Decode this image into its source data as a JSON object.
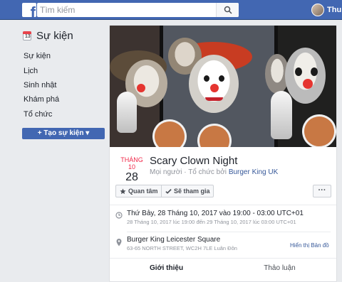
{
  "header": {
    "logo": "f",
    "search_placeholder": "Tìm kiếm",
    "user_name": "Thu"
  },
  "sidebar": {
    "title": "Sự kiện",
    "calendar_day": "13",
    "items": [
      {
        "label": "Sự kiện"
      },
      {
        "label": "Lịch"
      },
      {
        "label": "Sinh nhật"
      },
      {
        "label": "Khám phá"
      },
      {
        "label": "Tổ chức"
      }
    ],
    "create_button": "+ Tạo sự kiện ▾"
  },
  "event": {
    "month": "THÁNG 10",
    "day": "28",
    "title": "Scary Clown Night",
    "audience": "Mọi người · Tổ chức bởi",
    "organizer": "Burger King UK",
    "actions": {
      "interested": "Quan tâm",
      "going": "Sẽ tham gia",
      "more": "···"
    },
    "time_main": "Thứ Bảy, 28 Tháng 10, 2017 vào 19:00 - 03:00 UTC+01",
    "time_sub": "28 Tháng 10, 2017 lúc 19:00 đến 29 Tháng 10, 2017 lúc 03:00 UTC+01",
    "location_main": "Burger King Leicester Square",
    "location_sub": "63-65 NORTH STREET, WC2H 7LE Luân Đôn",
    "map_link": "Hiển thị Bản đồ",
    "tabs": [
      {
        "label": "Giới thiệu",
        "active": true
      },
      {
        "label": "Thảo luận",
        "active": false
      }
    ]
  },
  "colors": {
    "header_blue": "#4267b2",
    "link_blue": "#365899",
    "date_red": "#f02849"
  },
  "icons": {
    "search": "search-icon",
    "calendar": "calendar-icon",
    "star": "star-icon",
    "check": "check-icon",
    "clock": "clock-icon",
    "location": "location-pin-icon"
  }
}
